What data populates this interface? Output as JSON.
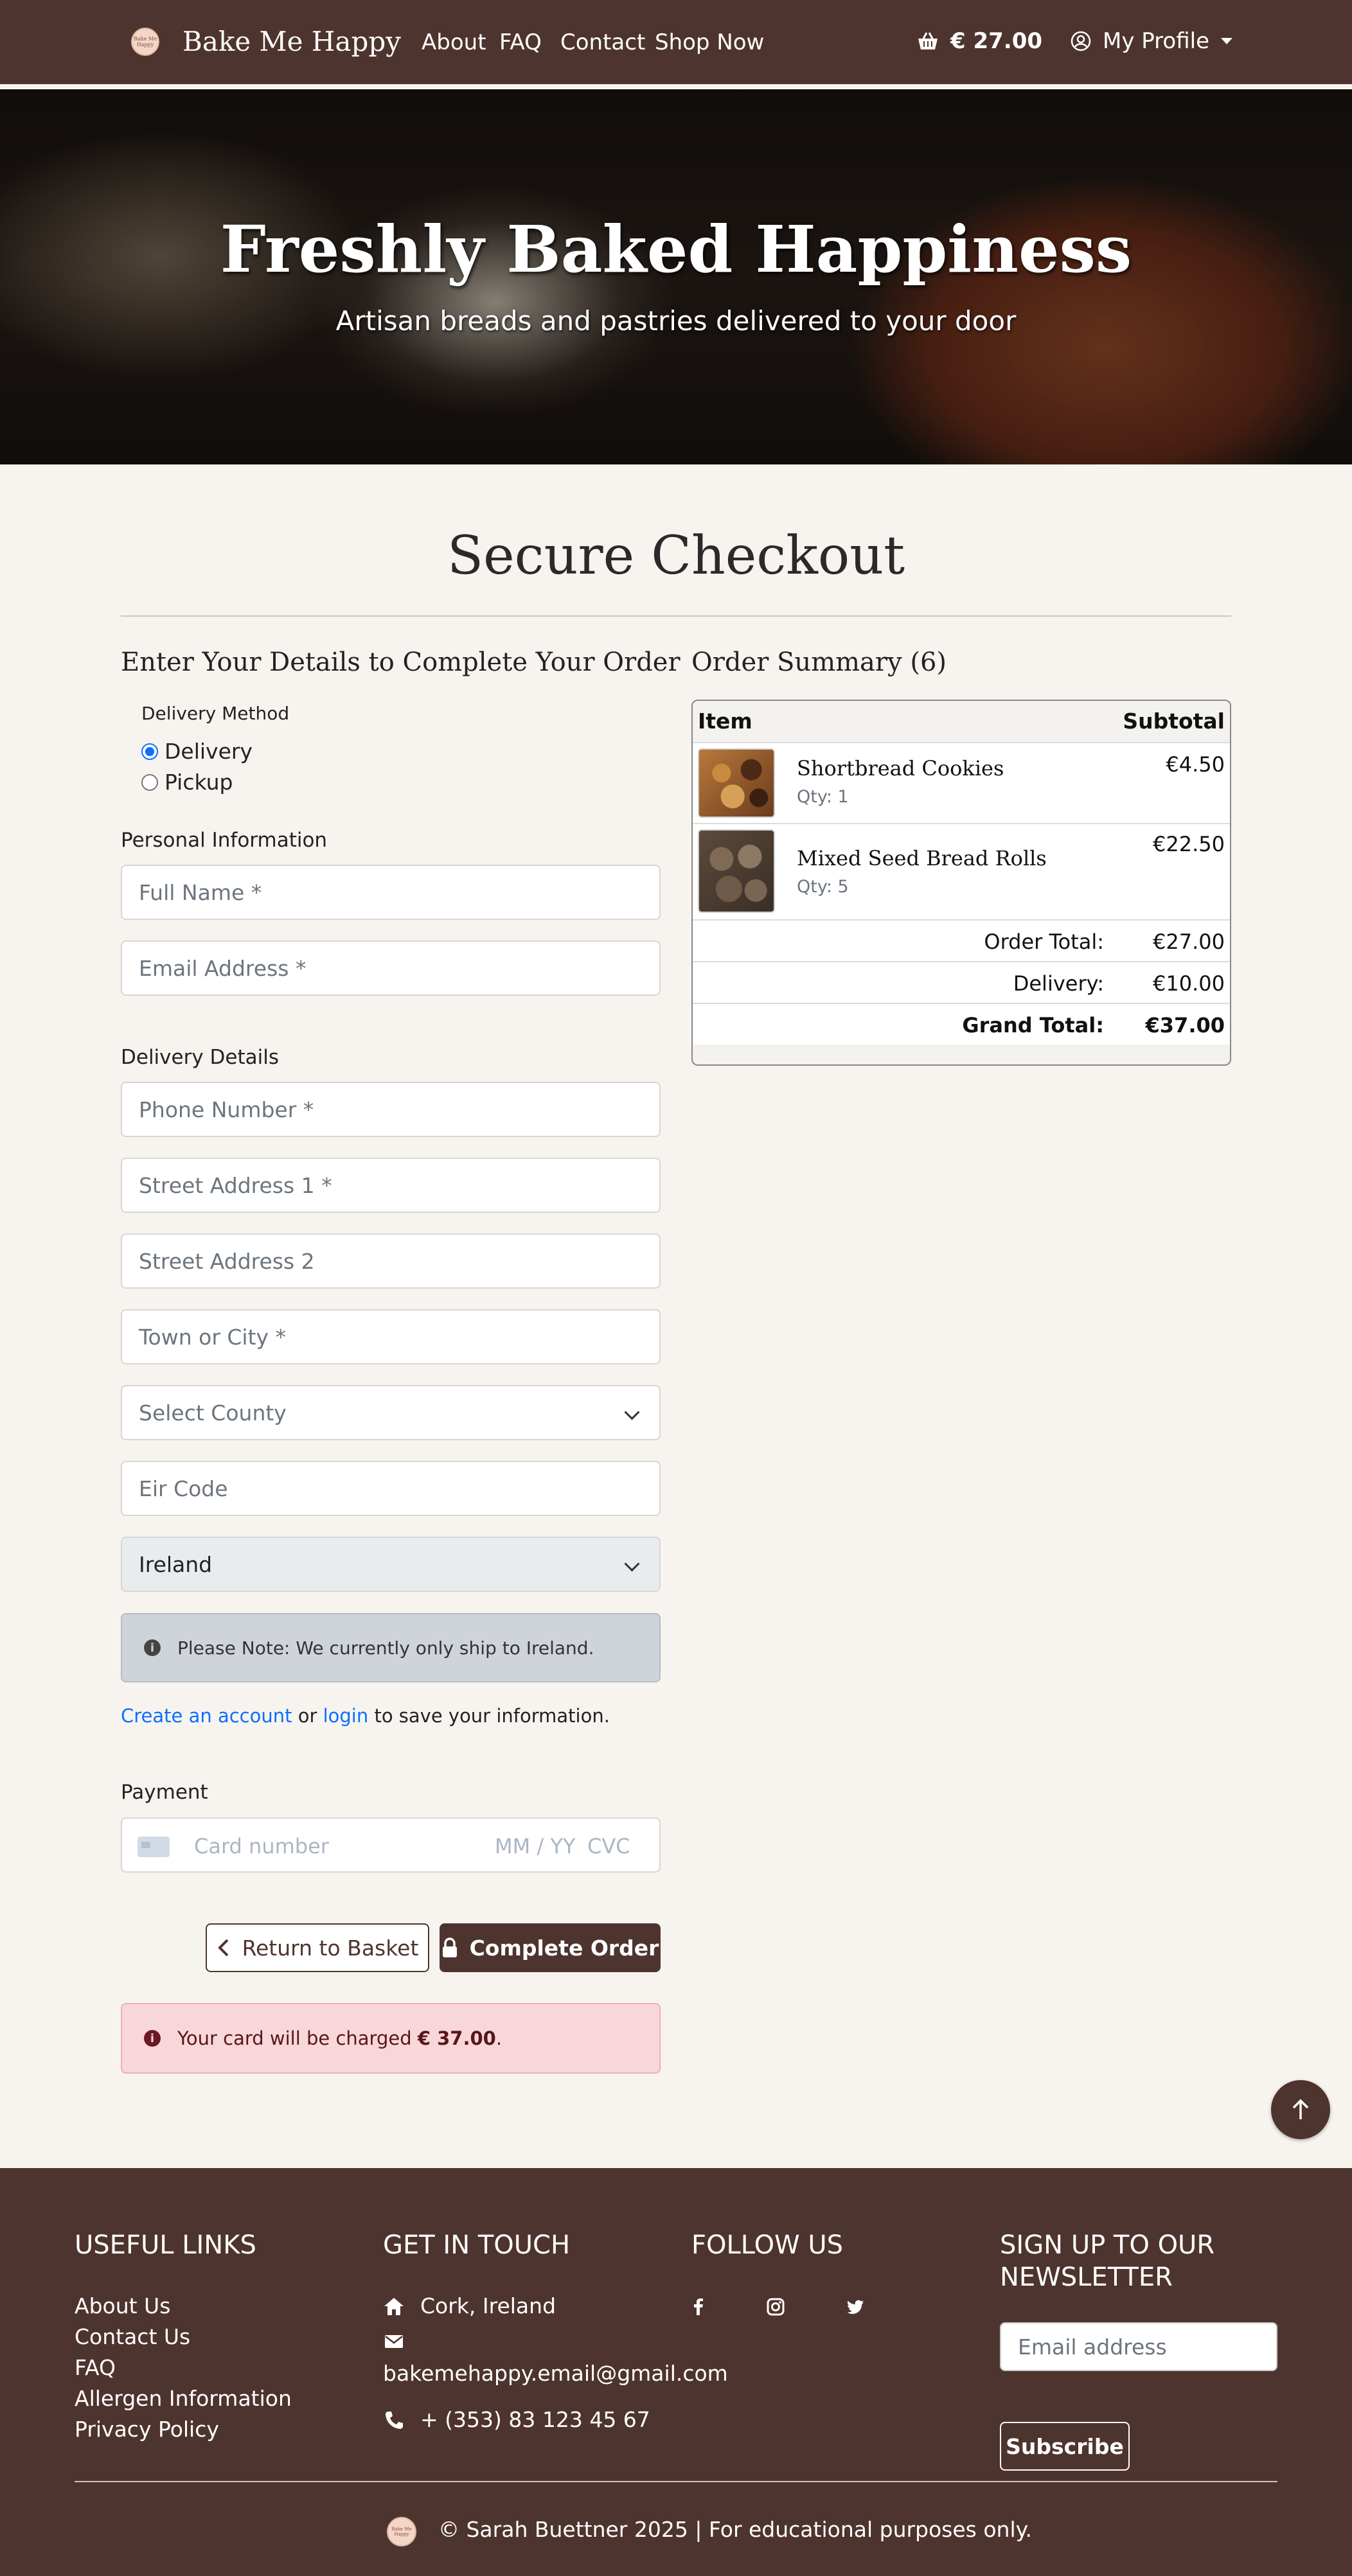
{
  "nav": {
    "logo_text": "Bake Me Happy",
    "brand": "Bake Me Happy",
    "links": [
      "About",
      "FAQ",
      "Contact",
      "Shop Now"
    ],
    "basket_total": "€ 27.00",
    "profile_label": "My Profile"
  },
  "hero": {
    "title": "Freshly Baked Happiness",
    "subtitle": "Artisan breads and pastries delivered to your door"
  },
  "checkout": {
    "title": "Secure Checkout",
    "details_heading": "Enter Your Details to Complete Your Order",
    "delivery_method_label": "Delivery Method",
    "delivery_options": [
      {
        "label": "Delivery",
        "selected": true
      },
      {
        "label": "Pickup",
        "selected": false
      }
    ],
    "personal_info_label": "Personal Information",
    "personal_fields": [
      "Full Name *",
      "Email Address *"
    ],
    "delivery_details_label": "Delivery Details",
    "delivery_fields": [
      "Phone Number *",
      "Street Address 1 *",
      "Street Address 2",
      "Town or City *"
    ],
    "county_placeholder": "Select County",
    "eircode_placeholder": "Eir Code",
    "country_value": "Ireland",
    "ship_note": "Please Note: We currently only ship to Ireland.",
    "account_line": {
      "create_link": "Create an account",
      "or": "or",
      "login_link": "login",
      "rest": "to save your information."
    },
    "payment_label": "Payment",
    "card": {
      "number_placeholder": "Card number",
      "expiry_placeholder": "MM / YY",
      "cvc_placeholder": "CVC"
    },
    "return_button": "Return to Basket",
    "complete_button": "Complete Order",
    "charge_prefix": "Your card will be charged",
    "charge_amount": "€ 37.00",
    "charge_suffix": "."
  },
  "summary": {
    "heading": "Order Summary (6)",
    "col_item": "Item",
    "col_subtotal": "Subtotal",
    "items": [
      {
        "name": "Shortbread Cookies",
        "qty": "Qty: 1",
        "subtotal": "€4.50"
      },
      {
        "name": "Mixed Seed Bread Rolls",
        "qty": "Qty: 5",
        "subtotal": "€22.50"
      }
    ],
    "order_total_label": "Order Total:",
    "order_total": "€27.00",
    "delivery_label": "Delivery:",
    "delivery": "€10.00",
    "grand_total_label": "Grand Total:",
    "grand_total": "€37.00"
  },
  "footer": {
    "useful_links_heading": "USEFUL LINKS",
    "useful_links": [
      "About Us",
      "Contact Us",
      "FAQ",
      "Allergen Information",
      "Privacy Policy"
    ],
    "contact_heading": "GET IN TOUCH",
    "location": "Cork, Ireland",
    "email": "bakemehappy.email@gmail.com",
    "phone": "+ (353) 83 123 45 67",
    "follow_heading": "FOLLOW US",
    "social_icons": [
      "facebook-icon",
      "instagram-icon",
      "twitter-icon"
    ],
    "newsletter_heading": "SIGN UP TO OUR NEWSLETTER",
    "newsletter_placeholder": "Email address",
    "subscribe": "Subscribe",
    "copyright": "© Sarah Buettner 2025 | For educational purposes only."
  },
  "colors": {
    "brand_brown": "#4e342e",
    "page_bg": "#f7f4ef",
    "link_blue": "#0d6efd",
    "danger_bg": "#f8d7da"
  }
}
